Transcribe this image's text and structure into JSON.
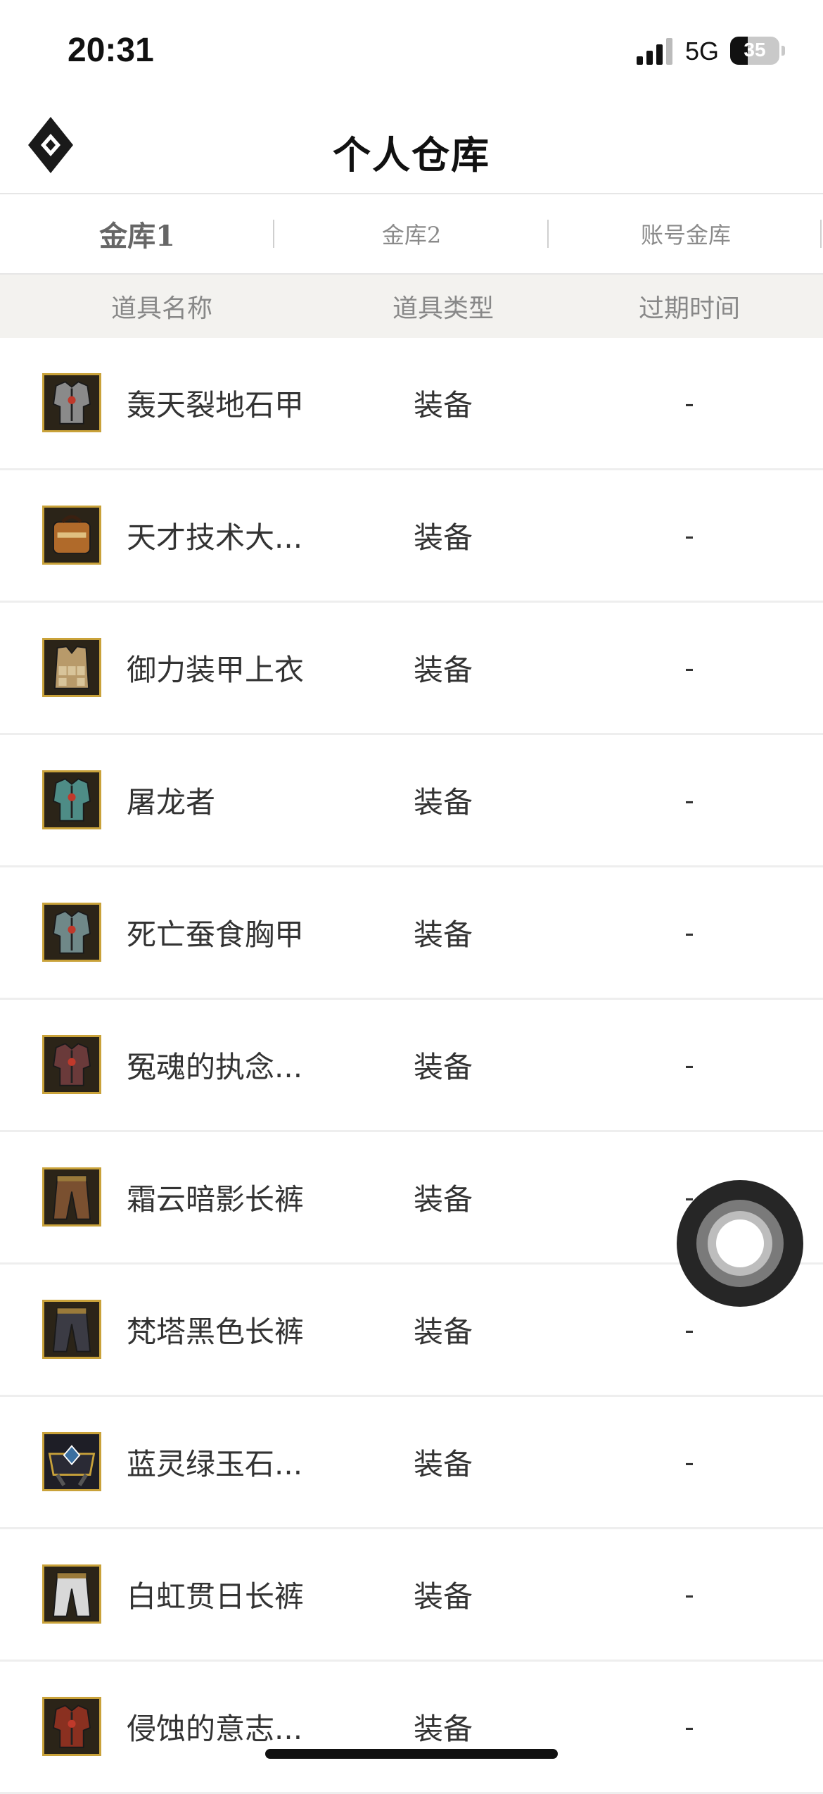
{
  "status_bar": {
    "time": "20:31",
    "network": "5G",
    "battery": "35"
  },
  "header": {
    "title": "个人仓库"
  },
  "tabs": [
    {
      "label": "金库1",
      "active": true
    },
    {
      "label": "金库2",
      "active": false
    },
    {
      "label": "账号金库",
      "active": false
    }
  ],
  "columns": {
    "name": "道具名称",
    "type": "道具类型",
    "expire": "过期时间"
  },
  "items": [
    {
      "name": "轰天裂地石甲",
      "type": "装备",
      "expire": "-",
      "icon": "armor-icon",
      "color": "#8a8a8a"
    },
    {
      "name": "天才技术大...",
      "type": "装备",
      "expire": "-",
      "icon": "bag-icon",
      "color": "#b06a2a"
    },
    {
      "name": "御力装甲上衣",
      "type": "装备",
      "expire": "-",
      "icon": "vest-icon",
      "color": "#b89a6a"
    },
    {
      "name": "屠龙者",
      "type": "装备",
      "expire": "-",
      "icon": "armor-icon",
      "color": "#4e8c86"
    },
    {
      "name": "死亡蚕食胸甲",
      "type": "装备",
      "expire": "-",
      "icon": "armor-icon",
      "color": "#6f8888"
    },
    {
      "name": "冤魂的执念...",
      "type": "装备",
      "expire": "-",
      "icon": "armor-icon",
      "color": "#6a3a3a"
    },
    {
      "name": "霜云暗影长裤",
      "type": "装备",
      "expire": "-",
      "icon": "pants-icon",
      "color": "#7a5030"
    },
    {
      "name": "梵塔黑色长裤",
      "type": "装备",
      "expire": "-",
      "icon": "pants-icon",
      "color": "#3b3b44"
    },
    {
      "name": "蓝灵绿玉石...",
      "type": "装备",
      "expire": "-",
      "icon": "belt-icon",
      "color": "#3a6fa0"
    },
    {
      "name": "白虹贯日长裤",
      "type": "装备",
      "expire": "-",
      "icon": "pants-icon",
      "color": "#d8d8d8"
    },
    {
      "name": "侵蚀的意志...",
      "type": "装备",
      "expire": "-",
      "icon": "armor-icon",
      "color": "#8a3020"
    }
  ]
}
